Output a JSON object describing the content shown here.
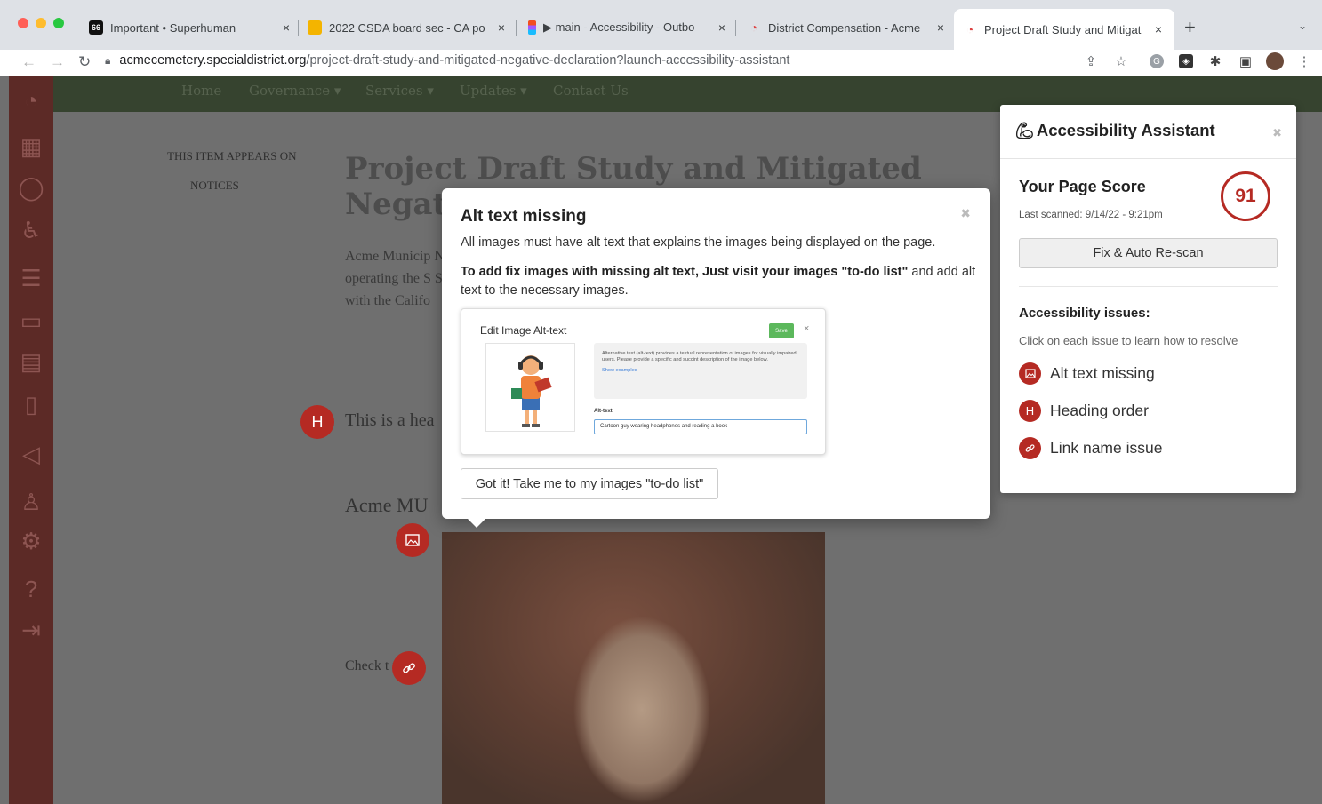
{
  "browser": {
    "tabs": [
      {
        "title": "Important • Superhuman",
        "favicon": "superhuman-icon",
        "fav_text": "66",
        "fav_color": "#111111"
      },
      {
        "title": "2022 CSDA board sec - CA po",
        "favicon": "slides-icon",
        "fav_text": "",
        "fav_color": "#f4b400"
      },
      {
        "title": "▶ main - Accessibility - Outbo",
        "favicon": "figma-icon",
        "fav_text": "",
        "fav_color": "#f24e1e"
      },
      {
        "title": "District Compensation - Acme",
        "favicon": "district-icon",
        "fav_text": "",
        "fav_color": "#d44"
      },
      {
        "title": "Project Draft Study and Mitigat",
        "favicon": "district-icon",
        "fav_text": "",
        "fav_color": "#d44"
      }
    ],
    "url_host": "acmecemetery.specialdistrict.org",
    "url_path": "/project-draft-study-and-mitigated-negative-declaration?launch-accessibility-assistant"
  },
  "site": {
    "nav": [
      "Home",
      "Governance ▾",
      "Services ▾",
      "Updates ▾",
      "Contact Us"
    ],
    "appears_on_label": "THIS ITEM APPEARS ON",
    "appears_on_item": "NOTICES",
    "title": "Project Draft Study and Mitigated Negat",
    "paragraph": "Acme Municip Negative Decla operating the S Sacramento in with the Califo",
    "heading_sample": "This is a hea",
    "acme_sub": "Acme MU",
    "check_text": "Check t        ut_"
  },
  "popup": {
    "title": "Alt text missing",
    "line1": "All images must have alt text that explains the images being displayed on the page.",
    "line2_bold": "To add fix images with missing alt text, Just visit your images \"to-do list\"",
    "line2_rest": " and add alt text to the necessary images.",
    "mock": {
      "title": "Edit Image Alt-text",
      "save": "Save",
      "desc": "Alternative text (alt-text) provides a textual representation of images for visually impaired users. Please provide a specific and succint description of the image below.",
      "examples": "Show examples",
      "alt_label": "Alt-text",
      "alt_value": "Cartoon guy wearing headphones and reading a book"
    },
    "button": "Got it! Take me to my images \"to-do list\""
  },
  "assistant": {
    "title": "Accessibility Assistant",
    "score_heading": "Your Page Score",
    "score": "91",
    "last_scanned": "Last scanned: 9/14/22 - 9:21pm",
    "fix_button": "Fix & Auto Re-scan",
    "issues_heading": "Accessibility issues:",
    "issues_sub": "Click on each issue to learn how to resolve",
    "issues": [
      {
        "label": "Alt text missing",
        "icon": "image-icon"
      },
      {
        "label": "Heading order",
        "icon": "heading-icon"
      },
      {
        "label": "Link name issue",
        "icon": "link-icon"
      }
    ],
    "accent": "#b52a23"
  }
}
